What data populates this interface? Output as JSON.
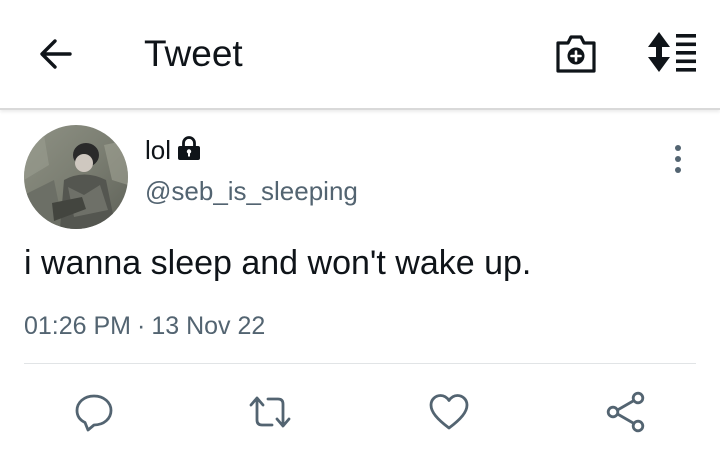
{
  "header": {
    "title": "Tweet",
    "back_icon": "arrow-left-icon",
    "camera_icon": "camera-plus-icon",
    "sort_icon": "sort-list-icon"
  },
  "tweet": {
    "display_name": "lol",
    "handle": "@seb_is_sleeping",
    "protected_icon": "lock-icon",
    "text": "i wanna sleep and won't wake up.",
    "time": "01:26 PM",
    "separator": "·",
    "date": "13 Nov 22",
    "more_icon": "more-vertical-icon"
  },
  "actions": [
    {
      "name": "reply",
      "icon": "reply-icon"
    },
    {
      "name": "retweet",
      "icon": "retweet-icon"
    },
    {
      "name": "like",
      "icon": "heart-icon"
    },
    {
      "name": "share",
      "icon": "share-icon"
    }
  ],
  "colors": {
    "text_primary": "#0f1419",
    "text_secondary": "#536471",
    "icon": "#536471",
    "divider": "#e1e4e6"
  }
}
